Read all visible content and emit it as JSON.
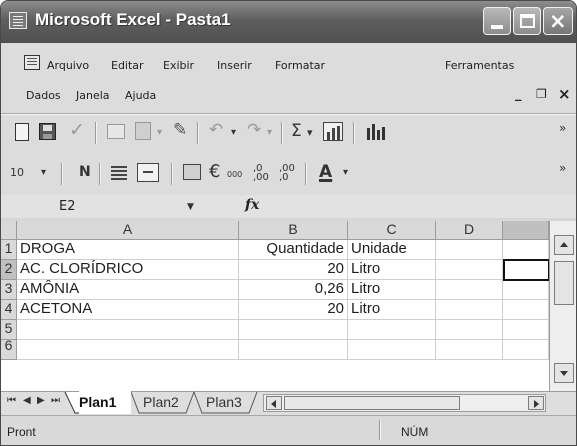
{
  "window": {
    "title": "Microsoft Excel - Pasta1"
  },
  "menu": {
    "row1": [
      "Arquivo",
      "Editar",
      "Exibir",
      "Inserir",
      "Formatar",
      "Ferramentas"
    ],
    "row2": [
      "Dados",
      "Janela",
      "Ajuda"
    ],
    "mdi_min": "_",
    "mdi_restore": "❐",
    "mdi_close": "×"
  },
  "toolbar_standard": {
    "sum_symbol": "Σ",
    "dropdown": "▾",
    "overflow": "»"
  },
  "toolbar_format": {
    "font_size": "10",
    "bold": "N",
    "euro": "€",
    "thousands": "000",
    "dec_increase": ",0 ,00",
    "font_color": "A"
  },
  "formula_bar": {
    "name_box": "E2",
    "fx": "fx",
    "content": ""
  },
  "sheet": {
    "columns": [
      "A",
      "B",
      "C",
      "D"
    ],
    "rows": [
      "1",
      "2",
      "3",
      "4",
      "5",
      "6"
    ],
    "cells": [
      [
        "DROGA",
        "Quantidade",
        "Unidade",
        ""
      ],
      [
        "AC. CLORÍDRICO",
        "20",
        "Litro",
        ""
      ],
      [
        "AMÔNIA",
        "0,26",
        "Litro",
        ""
      ],
      [
        "ACETONA",
        "20",
        "Litro",
        ""
      ],
      [
        "",
        "",
        "",
        ""
      ],
      [
        "",
        "",
        "",
        ""
      ]
    ],
    "active_cell": "E2"
  },
  "tabs": [
    "Plan1",
    "Plan2",
    "Plan3"
  ],
  "active_tab": "Plan1",
  "status": {
    "left": "Pront",
    "right": "NÚM"
  }
}
